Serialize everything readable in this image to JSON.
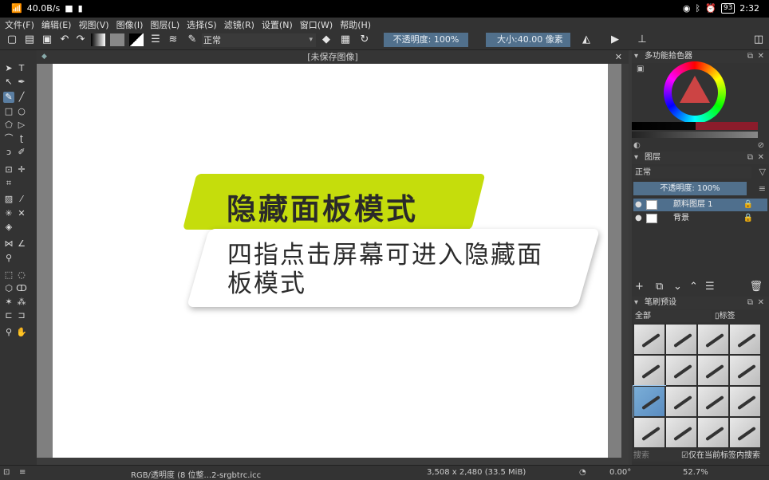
{
  "status_bar": {
    "net_speed": "40.0B/s",
    "battery": "93",
    "time": "2:32"
  },
  "menu": [
    "文件(F)",
    "编辑(E)",
    "视图(V)",
    "图像(I)",
    "图层(L)",
    "选择(S)",
    "滤镜(R)",
    "设置(N)",
    "窗口(W)",
    "帮助(H)"
  ],
  "toolbar": {
    "blend_mode": "正常",
    "opacity": "不透明度: 100%",
    "size_label": "大小",
    "size_value": "40.00 像素"
  },
  "document": {
    "title": "[未保存图像]"
  },
  "overlay": {
    "title": "隐藏面板模式",
    "body": "四指点击屏幕可进入隐藏面板模式"
  },
  "color_panel": {
    "title": "多功能拾色器"
  },
  "layers_panel": {
    "title": "图层",
    "blend_mode": "正常",
    "opacity": "不透明度: 100%",
    "layers": [
      {
        "name": "颜料图层 1",
        "selected": true
      },
      {
        "name": "背景",
        "selected": false
      }
    ]
  },
  "brush_panel": {
    "title": "笔刷预设",
    "filter": "全部",
    "tag_label": "标签",
    "search_placeholder": "搜索",
    "search_in_tag": "仅在当前标签内搜索"
  },
  "bottom_status": {
    "color_space": "RGB/透明度 (8 位整...2-srgbtrc.icc",
    "dimensions": "3,508 x 2,480 (33.5 MiB)",
    "rotation": "0.00°",
    "zoom": "52.7%"
  },
  "colors": {
    "accent_field": "#51708c",
    "banner_green": "#c5dd0c"
  }
}
